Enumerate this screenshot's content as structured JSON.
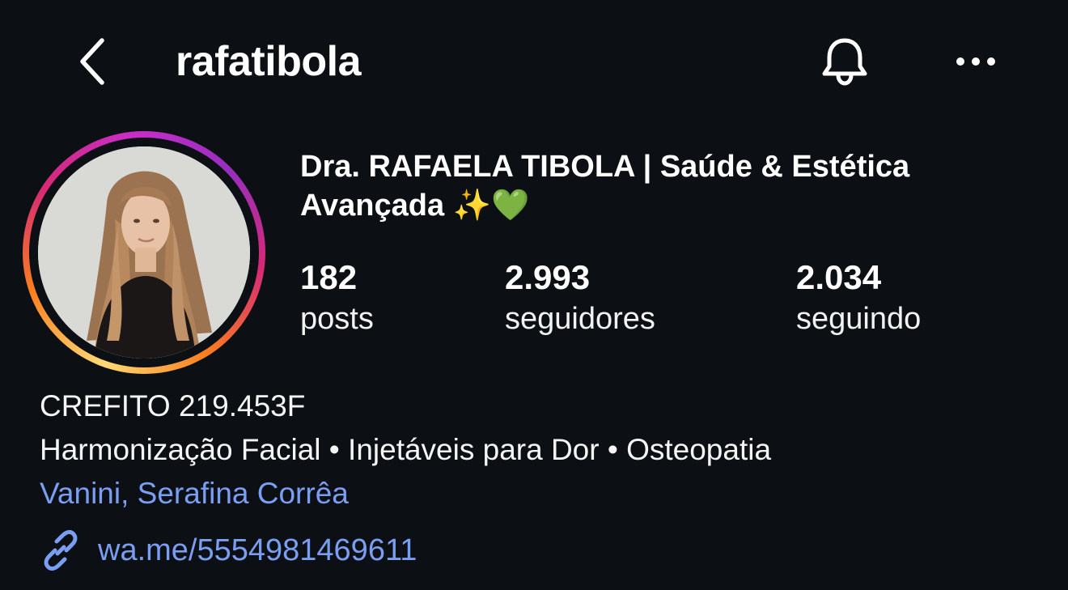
{
  "header": {
    "username": "rafatibola",
    "back_icon": "chevron-left-icon",
    "notification_icon": "bell-icon",
    "more_icon": "more-horizontal-icon"
  },
  "profile": {
    "display_name": "Dra. RAFAELA TIBOLA | Saúde & Estética Avançada ✨💚",
    "avatar_ring_colors": [
      "#feda75",
      "#fa7e1e",
      "#d62976",
      "#962fbf"
    ]
  },
  "stats": [
    {
      "value": "182",
      "label": "posts"
    },
    {
      "value": "2.993",
      "label": "seguidores"
    },
    {
      "value": "2.034",
      "label": "seguindo"
    }
  ],
  "bio": {
    "line1": "CREFITO 219.453F",
    "line2": "Harmonização Facial • Injetáveis para Dor • Osteopatia",
    "location": "Vanini, Serafina Corrêa",
    "link": "wa.me/5554981469611",
    "link_icon": "link-icon",
    "link_color": "#7a9ff2"
  }
}
